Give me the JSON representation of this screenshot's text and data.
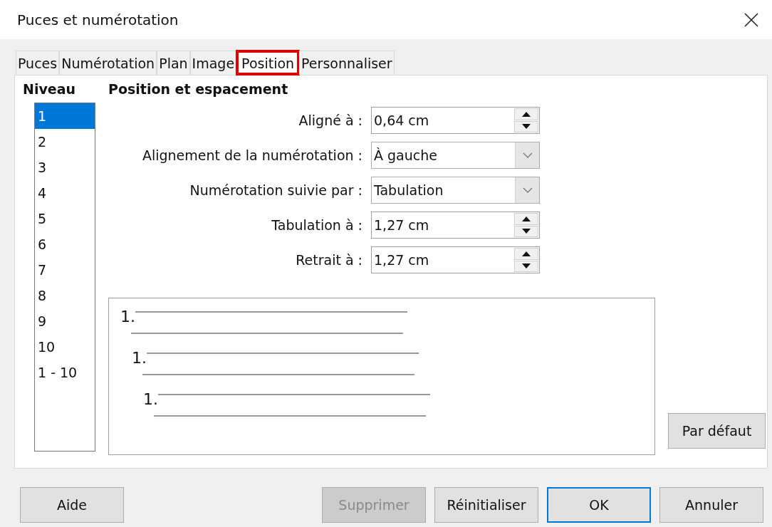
{
  "window": {
    "title": "Puces et numérotation"
  },
  "tabs": [
    {
      "label": "Puces",
      "selected": false
    },
    {
      "label": "Numérotation",
      "selected": false
    },
    {
      "label": "Plan",
      "selected": false
    },
    {
      "label": "Image",
      "selected": false
    },
    {
      "label": "Position",
      "selected": true
    },
    {
      "label": "Personnaliser",
      "selected": false
    }
  ],
  "level_list": {
    "title": "Niveau",
    "items": [
      {
        "label": "1",
        "selected": true
      },
      {
        "label": "2",
        "selected": false
      },
      {
        "label": "3",
        "selected": false
      },
      {
        "label": "4",
        "selected": false
      },
      {
        "label": "5",
        "selected": false
      },
      {
        "label": "6",
        "selected": false
      },
      {
        "label": "7",
        "selected": false
      },
      {
        "label": "8",
        "selected": false
      },
      {
        "label": "9",
        "selected": false
      },
      {
        "label": "10",
        "selected": false
      },
      {
        "label": "1 - 10",
        "selected": false
      }
    ]
  },
  "section_title": "Position et espacement",
  "fields": [
    {
      "kind": "spin",
      "label": "Aligné à :",
      "value": "0,64 cm"
    },
    {
      "kind": "dropdown",
      "label": "Alignement de la numérotation :",
      "value": "À gauche"
    },
    {
      "kind": "dropdown",
      "label": "Numérotation suivie par :",
      "value": "Tabulation"
    },
    {
      "kind": "spin",
      "label": "Tabulation à :",
      "value": "1,27 cm"
    },
    {
      "kind": "spin",
      "label": "Retrait à :",
      "value": "1,27 cm"
    }
  ],
  "preview": {
    "items": [
      {
        "label": "1."
      },
      {
        "label": "1."
      },
      {
        "label": "1."
      }
    ]
  },
  "default_button": "Par défaut",
  "buttons": [
    {
      "label": "Aide",
      "disabled": false,
      "default": false
    },
    {
      "label": "Supprimer",
      "disabled": true,
      "default": false
    },
    {
      "label": "Réinitialiser",
      "disabled": false,
      "default": false
    },
    {
      "label": "OK",
      "disabled": false,
      "default": true
    },
    {
      "label": "Annuler",
      "disabled": false,
      "default": false
    }
  ]
}
